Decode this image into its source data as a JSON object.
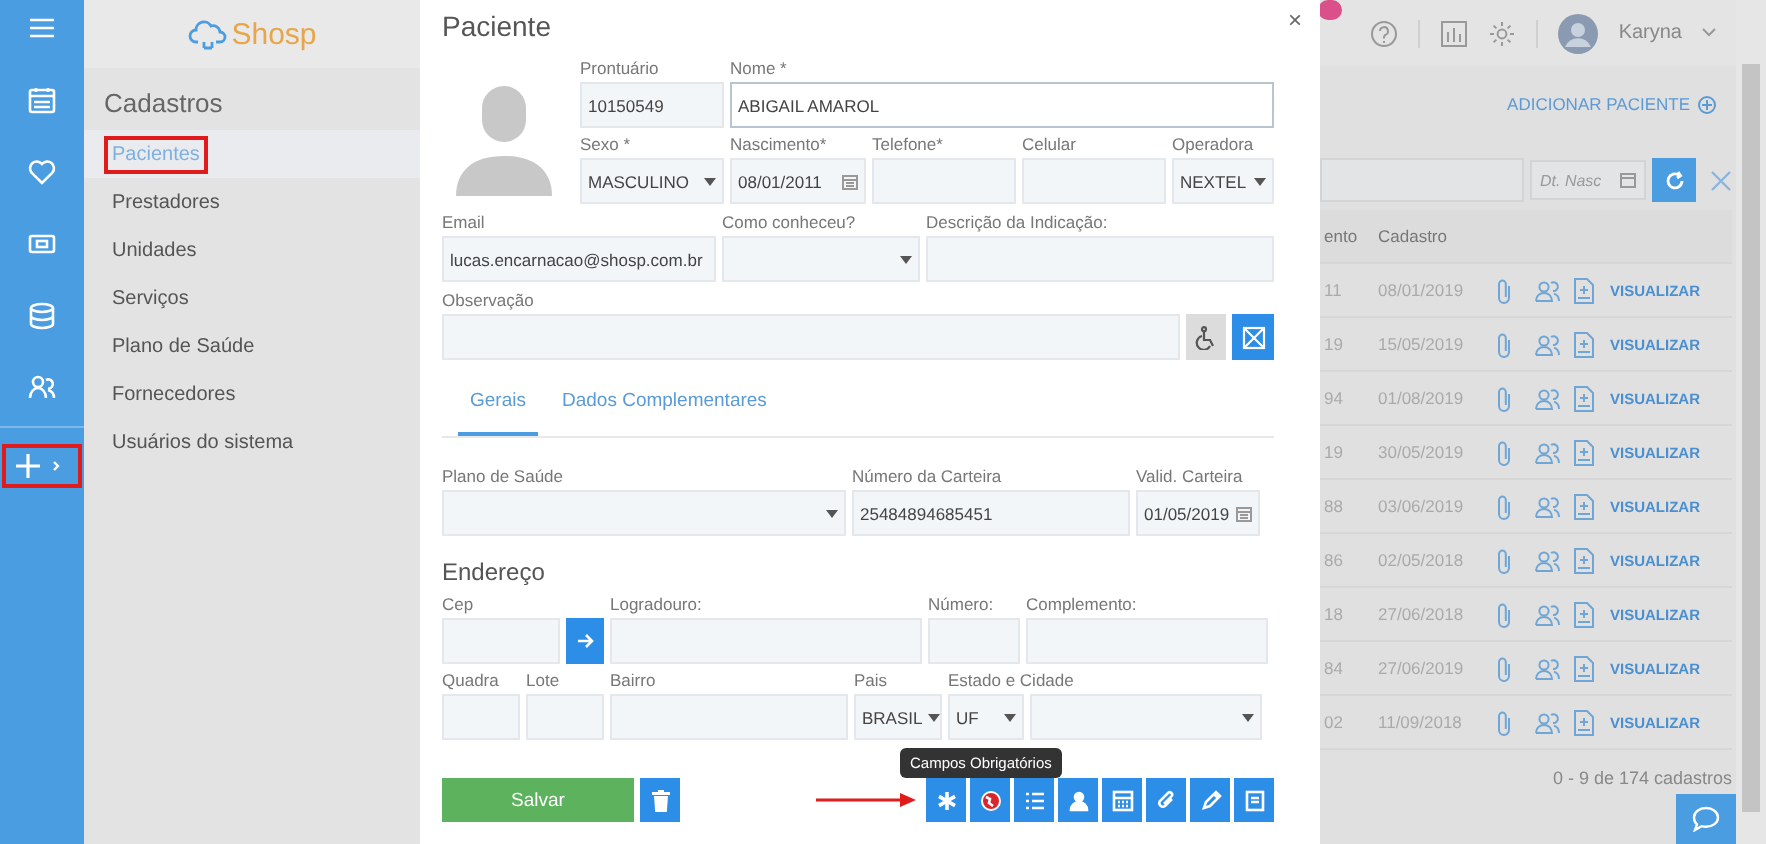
{
  "rail": {
    "items": [
      {
        "annotated": false
      },
      {
        "annotated": false
      },
      {
        "annotated": false
      },
      {
        "annotated": false
      },
      {
        "annotated": false
      },
      {
        "annotated": false
      },
      {
        "annotated": true
      }
    ]
  },
  "sidebar": {
    "logo": "Shosp",
    "title": "Cadastros",
    "items": [
      {
        "label": "Pacientes",
        "selected": true,
        "annotated": true
      },
      {
        "label": "Prestadores",
        "selected": false,
        "annotated": false
      },
      {
        "label": "Unidades",
        "selected": false,
        "annotated": false
      },
      {
        "label": "Serviços",
        "selected": false,
        "annotated": false
      },
      {
        "label": "Plano de Saúde",
        "selected": false,
        "annotated": false
      },
      {
        "label": "Fornecedores",
        "selected": false,
        "annotated": false
      },
      {
        "label": "Usuários do sistema",
        "selected": false,
        "annotated": false
      }
    ]
  },
  "topbar": {
    "user": "Karyna"
  },
  "page": {
    "add_link": "ADICIONAR PACIENTE",
    "date_filter": {
      "placeholder": "Dt. Nasc"
    },
    "table": {
      "columns": [
        "ento",
        "Cadastro"
      ],
      "rows": [
        {
          "column_1": "11",
          "cadastro": "08/01/2019",
          "action": "VISUALIZAR"
        },
        {
          "column_1": "19",
          "cadastro": "15/05/2019",
          "action": "VISUALIZAR"
        },
        {
          "column_1": "94",
          "cadastro": "01/08/2019",
          "action": "VISUALIZAR"
        },
        {
          "column_1": "19",
          "cadastro": "30/05/2019",
          "action": "VISUALIZAR"
        },
        {
          "column_1": "88",
          "cadastro": "03/06/2019",
          "action": "VISUALIZAR"
        },
        {
          "column_1": "86",
          "cadastro": "02/05/2018",
          "action": "VISUALIZAR"
        },
        {
          "column_1": "18",
          "cadastro": "27/06/2018",
          "action": "VISUALIZAR"
        },
        {
          "column_1": "84",
          "cadastro": "27/06/2019",
          "action": "VISUALIZAR"
        },
        {
          "column_1": "02",
          "cadastro": "11/09/2018",
          "action": "VISUALIZAR"
        }
      ]
    },
    "footer": "0 - 9 de 174 cadastros"
  },
  "modal": {
    "title": "Paciente",
    "close": "×",
    "fields": [
      {
        "label": "Prontuário",
        "value": "10150549",
        "kind": "text",
        "focused": false
      },
      {
        "label": "Nome *",
        "value": "ABIGAIL AMAROL",
        "kind": "text",
        "focused": true
      },
      {
        "label": "Sexo *",
        "value": "MASCULINO",
        "kind": "select",
        "focused": false
      },
      {
        "label": "Nascimento*",
        "value": "08/01/2011",
        "kind": "date",
        "focused": false
      },
      {
        "label": "Telefone*",
        "kind": "text",
        "focused": false
      },
      {
        "label": "Celular",
        "kind": "text",
        "focused": false
      },
      {
        "label": "Operadora",
        "value": "NEXTEL",
        "kind": "select",
        "focused": false
      },
      {
        "label": "Email",
        "value": "lucas.encarnacao@shosp.com.br",
        "kind": "text",
        "focused": false
      },
      {
        "label": "Como conheceu?",
        "kind": "select",
        "focused": false
      },
      {
        "label": "Descrição da Indicação:",
        "kind": "text",
        "focused": false
      },
      {
        "label": "Observação",
        "kind": "text",
        "focused": false
      },
      {
        "label": "Plano de Saúde",
        "kind": "select",
        "focused": false
      },
      {
        "label": "Número da Carteira",
        "value": "25484894685451",
        "kind": "text",
        "focused": false
      },
      {
        "label": "Valid. Carteira",
        "value": "01/05/2019",
        "kind": "date",
        "focused": false
      },
      {
        "label": "Cep",
        "kind": "text",
        "focused": false
      },
      {
        "label": "Logradouro:",
        "kind": "text",
        "focused": false
      },
      {
        "label": "Número:",
        "kind": "text",
        "focused": false
      },
      {
        "label": "Complemento:",
        "kind": "text",
        "focused": false
      },
      {
        "label": "Quadra",
        "kind": "text",
        "focused": false
      },
      {
        "label": "Lote",
        "kind": "text",
        "focused": false
      },
      {
        "label": "Bairro",
        "kind": "text",
        "focused": false
      },
      {
        "label": "Pais",
        "value": "BRASIL",
        "kind": "select",
        "focused": false
      },
      {
        "label": "Estado e Cidade",
        "value": "UF",
        "kind": "select",
        "focused": false
      },
      {
        "kind": "select",
        "focused": false
      }
    ],
    "tabs": [
      {
        "label": "Gerais",
        "selected": true
      },
      {
        "label": "Dados Complementares",
        "selected": false
      }
    ],
    "address_heading": "Endereço",
    "save": "Salvar",
    "tooltip": "Campos Obrigatórios",
    "action_buttons": [
      {
        "annotated": true
      },
      {
        "annotated": false
      },
      {
        "annotated": false
      },
      {
        "annotated": false
      },
      {
        "annotated": false
      },
      {
        "annotated": false
      },
      {
        "annotated": false
      },
      {
        "annotated": false
      }
    ]
  }
}
